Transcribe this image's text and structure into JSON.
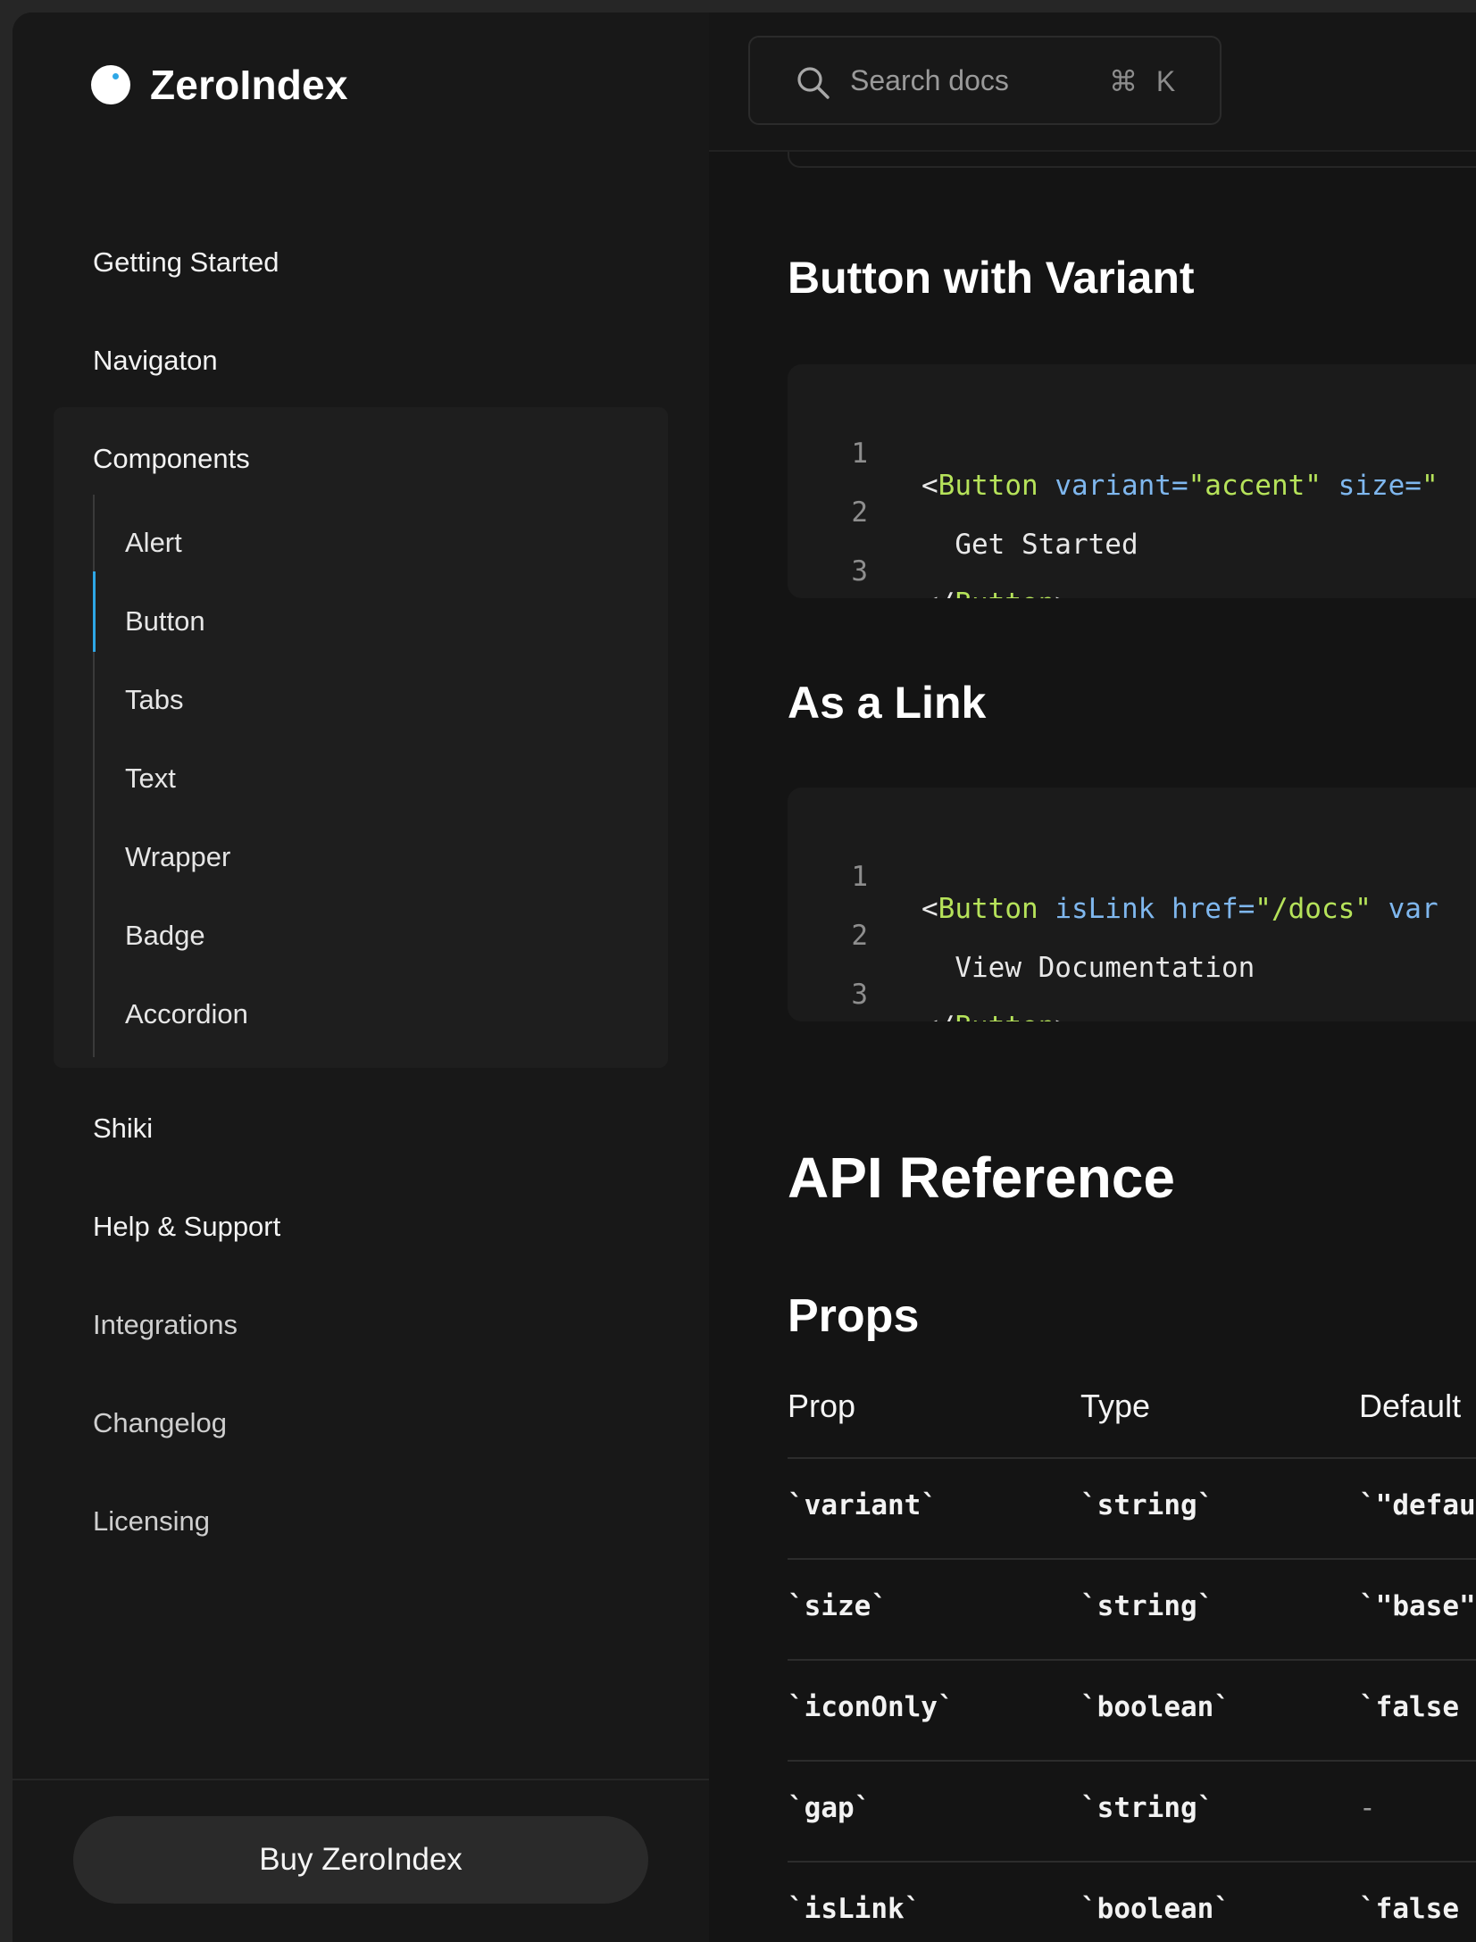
{
  "brand": {
    "name": "ZeroIndex"
  },
  "sidebar": {
    "items": [
      {
        "label": "Getting Started"
      },
      {
        "label": "Navigaton"
      },
      {
        "label": "Components"
      },
      {
        "label": "Shiki"
      },
      {
        "label": "Help & Support"
      },
      {
        "label": "Integrations"
      },
      {
        "label": "Changelog"
      },
      {
        "label": "Licensing"
      }
    ],
    "components": [
      {
        "label": "Alert"
      },
      {
        "label": "Button",
        "active": true
      },
      {
        "label": "Tabs"
      },
      {
        "label": "Text"
      },
      {
        "label": "Wrapper"
      },
      {
        "label": "Badge"
      },
      {
        "label": "Accordion"
      }
    ],
    "buy_label": "Buy ZeroIndex"
  },
  "search": {
    "placeholder": "Search docs",
    "shortcut": "⌘ K"
  },
  "content": {
    "section_variant_title": "Button with Variant",
    "code_variant": {
      "line_numbers": [
        "1",
        "2",
        "3"
      ],
      "line1_open": "<",
      "line1_tag": "Button",
      "line1_attr1": " variant=",
      "line1_val1": "\"accent\"",
      "line1_attr2": " size=",
      "line1_val2": "\"",
      "line2": "  Get Started",
      "line3_open": "</",
      "line3_tag": "Button",
      "line3_close": ">"
    },
    "section_link_title": "As a Link",
    "code_link": {
      "line_numbers": [
        "1",
        "2",
        "3"
      ],
      "line1_open": "<",
      "line1_tag": "Button",
      "line1_attr1": " isLink",
      "line1_attr2": " href=",
      "line1_val2": "\"/docs\"",
      "line1_attr3": " var",
      "line2": "  View Documentation",
      "line3_open": "</",
      "line3_tag": "Button",
      "line3_close": ">"
    },
    "api_title": "API Reference",
    "props_title": "Props",
    "table": {
      "headers": [
        "Prop",
        "Type",
        "Default"
      ],
      "rows": [
        [
          "`variant`",
          "`string`",
          "`\"defau"
        ],
        [
          "`size`",
          "`string`",
          "`\"base\""
        ],
        [
          "`iconOnly`",
          "`boolean`",
          "`false"
        ],
        [
          "`gap`",
          "`string`",
          "-"
        ],
        [
          "`isLink`",
          "`boolean`",
          "`false"
        ]
      ]
    }
  },
  "colors": {
    "accent": "#2ea7e6",
    "code_tag": "#b6e35a",
    "code_attr": "#7fb7ee",
    "background": "#161616"
  }
}
